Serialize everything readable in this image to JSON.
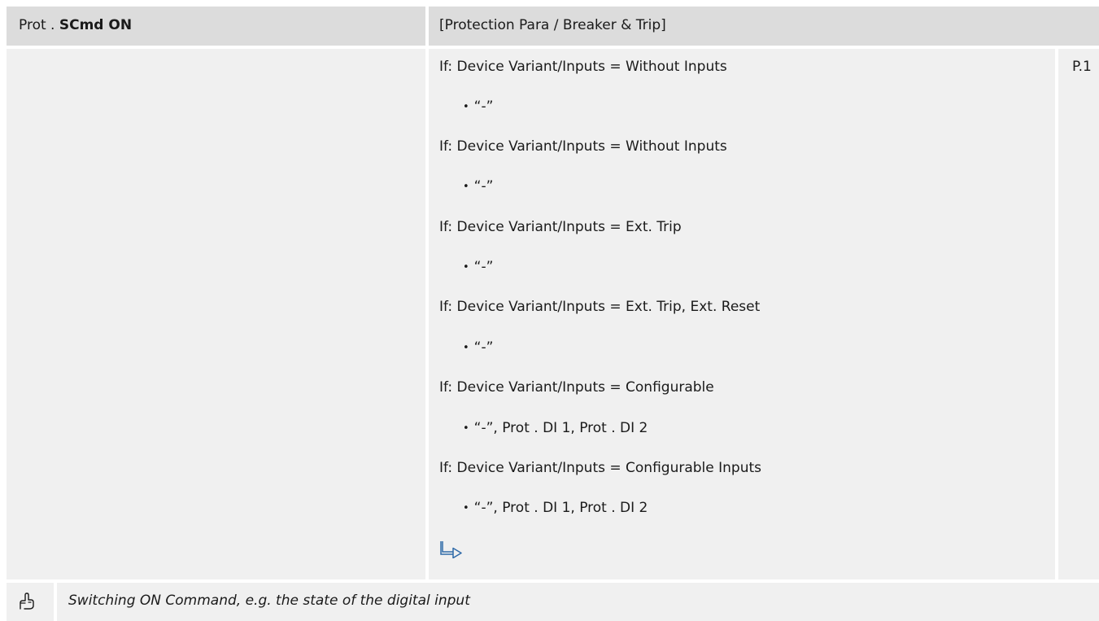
{
  "header": {
    "module": "Prot",
    "separator": ".",
    "parameter": "SCmd ON",
    "menu_path": "[Protection Para / Breaker & Trip]"
  },
  "page_ref": "P.1",
  "conditions": [
    {
      "text": "If: Device Variant/Inputs = Without Inputs",
      "option": "“-”"
    },
    {
      "text": "If: Device Variant/Inputs = Without Inputs",
      "option": "“-”"
    },
    {
      "text": "If: Device Variant/Inputs = Ext. Trip",
      "option": "“-”"
    },
    {
      "text": "If: Device Variant/Inputs = Ext. Trip, Ext. Reset",
      "option": "“-”"
    },
    {
      "text": "If: Device Variant/Inputs = Configurable",
      "option": "“-”, Prot . DI 1, Prot . DI 2"
    },
    {
      "text": "If: Device Variant/Inputs = Configurable Inputs",
      "option": "“-”, Prot . DI 1, Prot . DI 2"
    }
  ],
  "bullet": "•",
  "icons": {
    "reference_arrow": "reference-arrow-icon",
    "description": "hand-pointer-icon"
  },
  "description": "Switching ON Command, e.g. the state of the digital input",
  "colors": {
    "header_bg": "#dcdcdc",
    "cell_bg": "#f0f0f0",
    "link_blue": "#2f6aa8"
  }
}
